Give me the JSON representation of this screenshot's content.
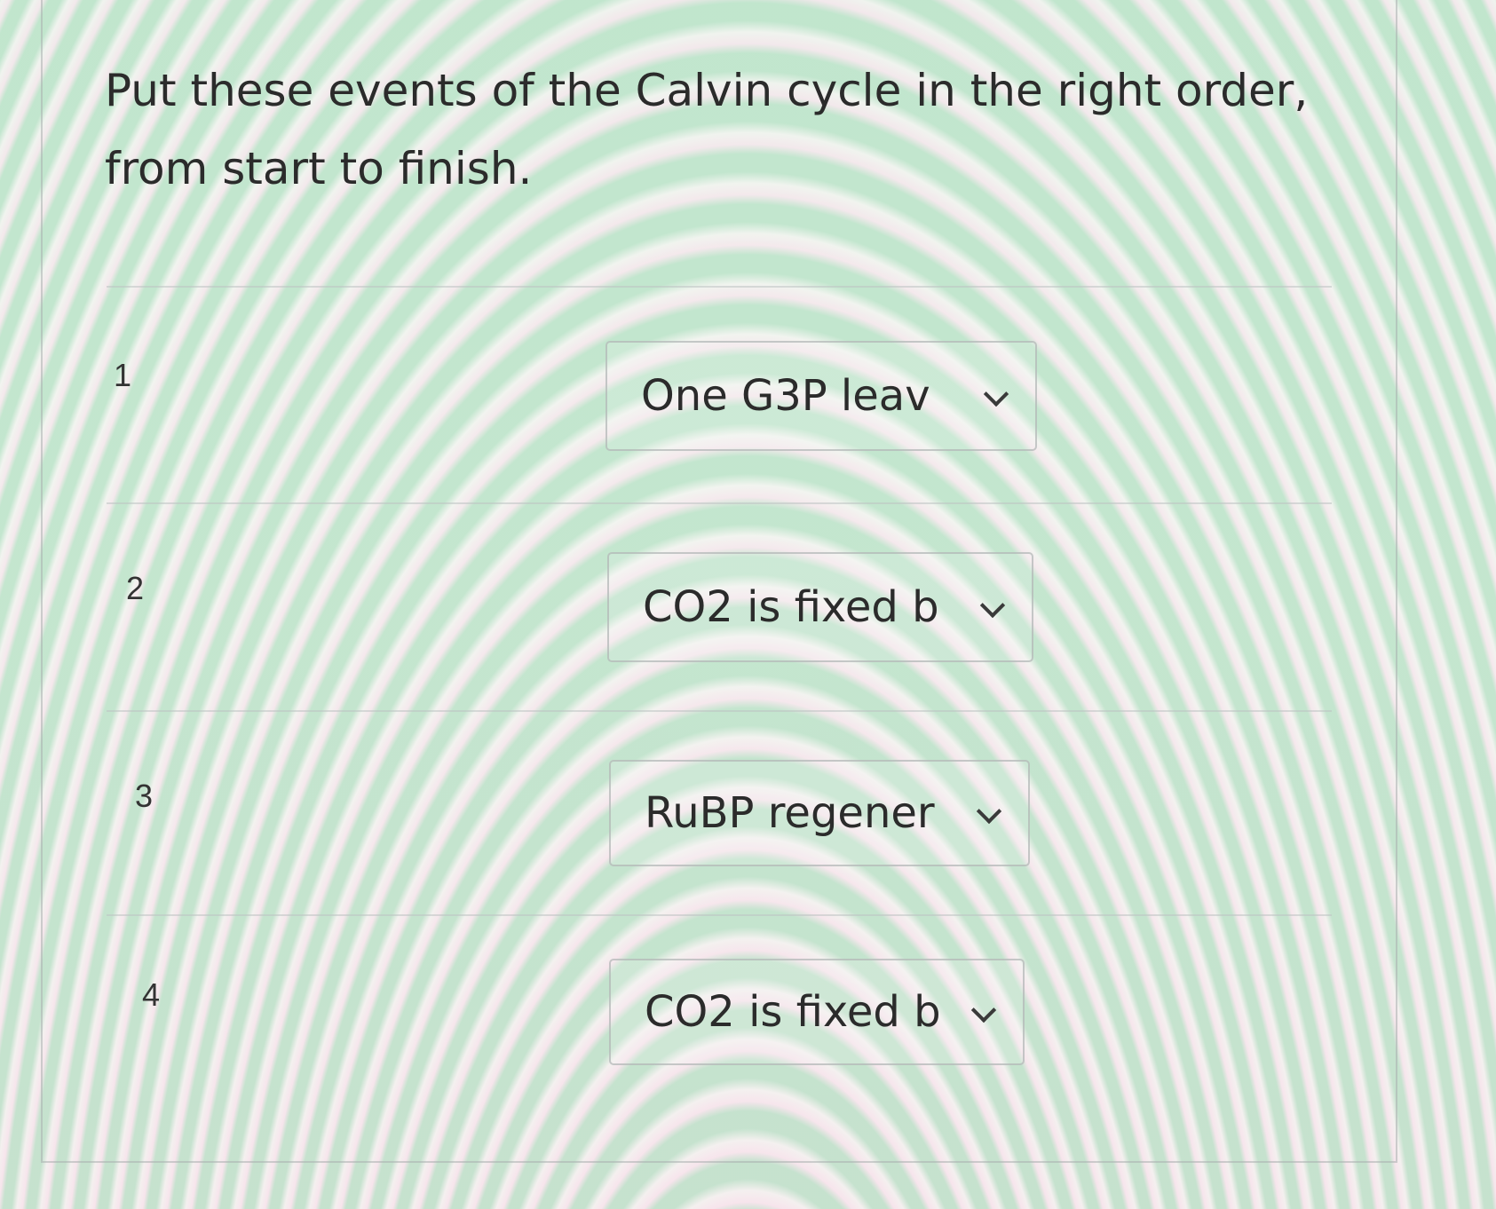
{
  "question": {
    "text": "Put these events of the Calvin cycle in the right order, from start to finish."
  },
  "rows": [
    {
      "number": "1",
      "selected": "One G3P leav",
      "icon": "chevron-down-icon"
    },
    {
      "number": "2",
      "selected": "CO2 is fixed b",
      "icon": "chevron-down-icon"
    },
    {
      "number": "3",
      "selected": "RuBP regener",
      "icon": "chevron-down-icon"
    },
    {
      "number": "4",
      "selected": "CO2 is fixed b",
      "icon": "chevron-down-icon"
    }
  ]
}
